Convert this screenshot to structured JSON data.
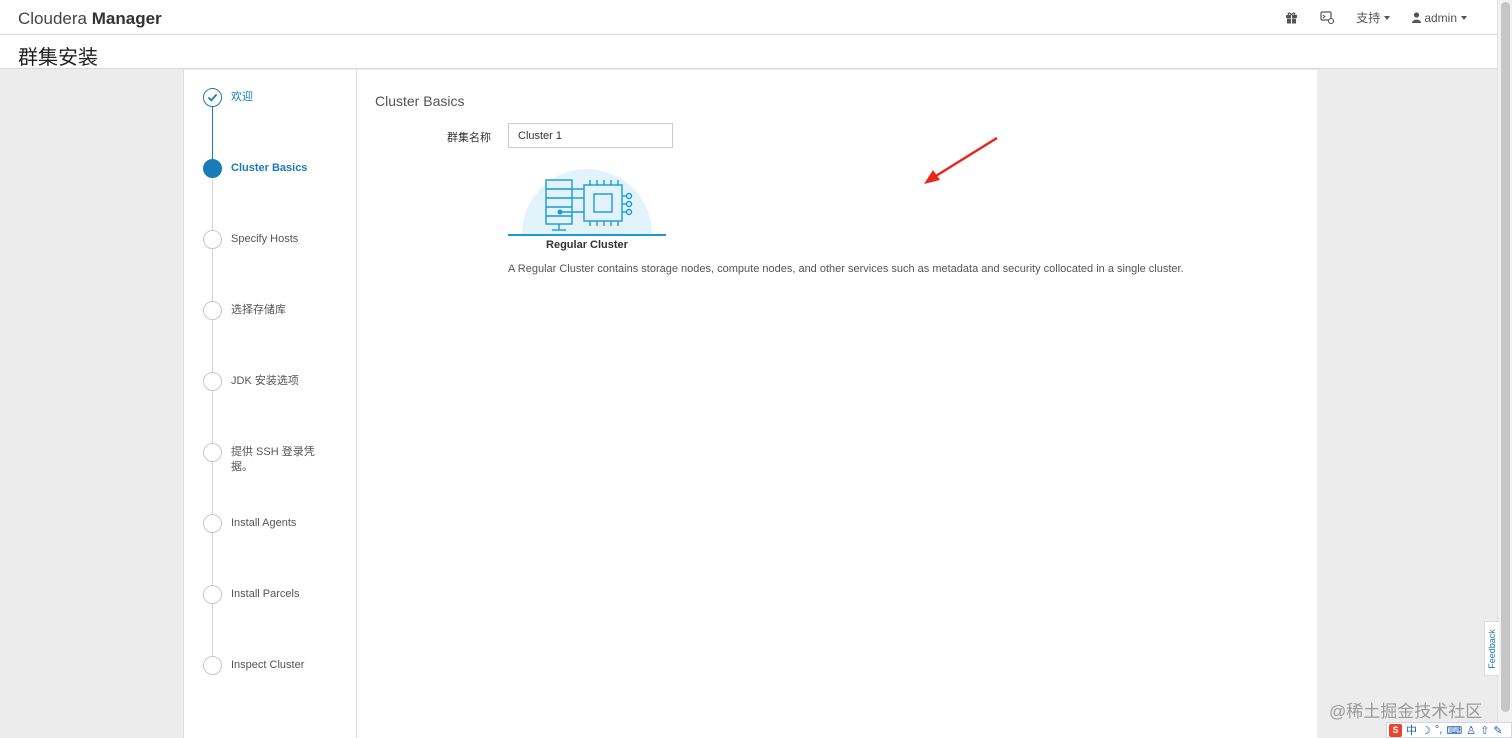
{
  "header": {
    "brand_light": "Cloudera",
    "brand_bold": "Manager",
    "support_label": "支持",
    "user_label": "admin"
  },
  "page": {
    "title": "群集安装"
  },
  "wizard": {
    "steps": [
      {
        "label": "欢迎",
        "state": "done"
      },
      {
        "label": "Cluster Basics",
        "state": "active"
      },
      {
        "label": "Specify Hosts",
        "state": "pending"
      },
      {
        "label": "选择存储库",
        "state": "pending"
      },
      {
        "label": "JDK 安装选项",
        "state": "pending"
      },
      {
        "label": "提供 SSH 登录凭据。",
        "state": "pending"
      },
      {
        "label": "Install Agents",
        "state": "pending"
      },
      {
        "label": "Install Parcels",
        "state": "pending"
      },
      {
        "label": "Inspect Cluster",
        "state": "pending"
      }
    ]
  },
  "content": {
    "section_title": "Cluster Basics",
    "cluster_name_label": "群集名称",
    "cluster_name_value": "Cluster 1",
    "cluster_type_name": "Regular Cluster",
    "cluster_type_description": "A Regular Cluster contains storage nodes, compute nodes, and other services such as metadata and security collocated in a single cluster."
  },
  "feedback_label": "Feedback",
  "watermark": "@稀土掘金技术社区",
  "ime": {
    "mode": "中"
  },
  "colors": {
    "accent": "#1a7cb7",
    "illustration": "#1a9ad6",
    "annotation_arrow": "#e8261d"
  }
}
